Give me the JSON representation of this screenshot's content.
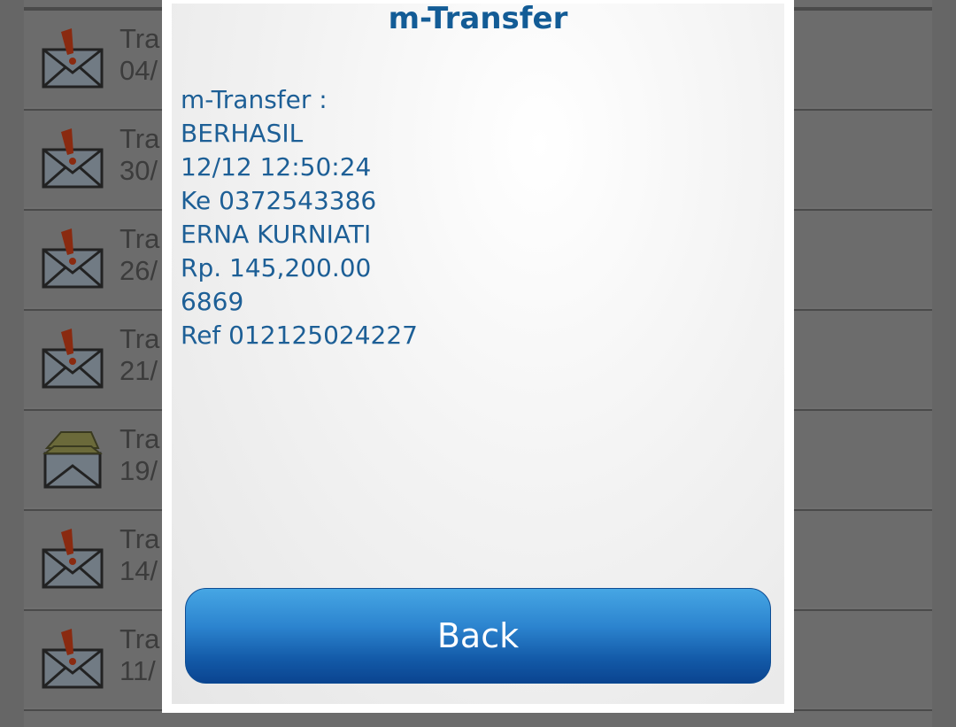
{
  "dialog": {
    "title": "m-Transfer",
    "lines": [
      "m-Transfer :",
      "BERHASIL",
      "12/12 12:50:24",
      "Ke 0372543386",
      "ERNA KURNIATI",
      "Rp. 145,200.00",
      "6869",
      "Ref 012125024227"
    ],
    "back_label": "Back"
  },
  "inbox": {
    "items": [
      {
        "title": "Tra",
        "date": "04/",
        "icon": "unread-alert-envelope-icon"
      },
      {
        "title": "Tra",
        "date": "30/",
        "icon": "unread-alert-envelope-icon"
      },
      {
        "title": "Tra",
        "date": "26/",
        "icon": "unread-alert-envelope-icon"
      },
      {
        "title": "Tra",
        "date": "21/",
        "icon": "unread-alert-envelope-icon"
      },
      {
        "title": "Tra",
        "date": "19/",
        "icon": "opened-envelope-icon"
      },
      {
        "title": "Tra",
        "date": "14/",
        "icon": "unread-alert-envelope-icon"
      },
      {
        "title": "Tra",
        "date": "11/",
        "icon": "unread-alert-envelope-icon"
      }
    ]
  },
  "colors": {
    "title": "#135c96",
    "message_text": "#1d5f96",
    "button_top": "#46a6e4",
    "button_bottom": "#0a4490",
    "alert_mark": "#b33a1a"
  }
}
